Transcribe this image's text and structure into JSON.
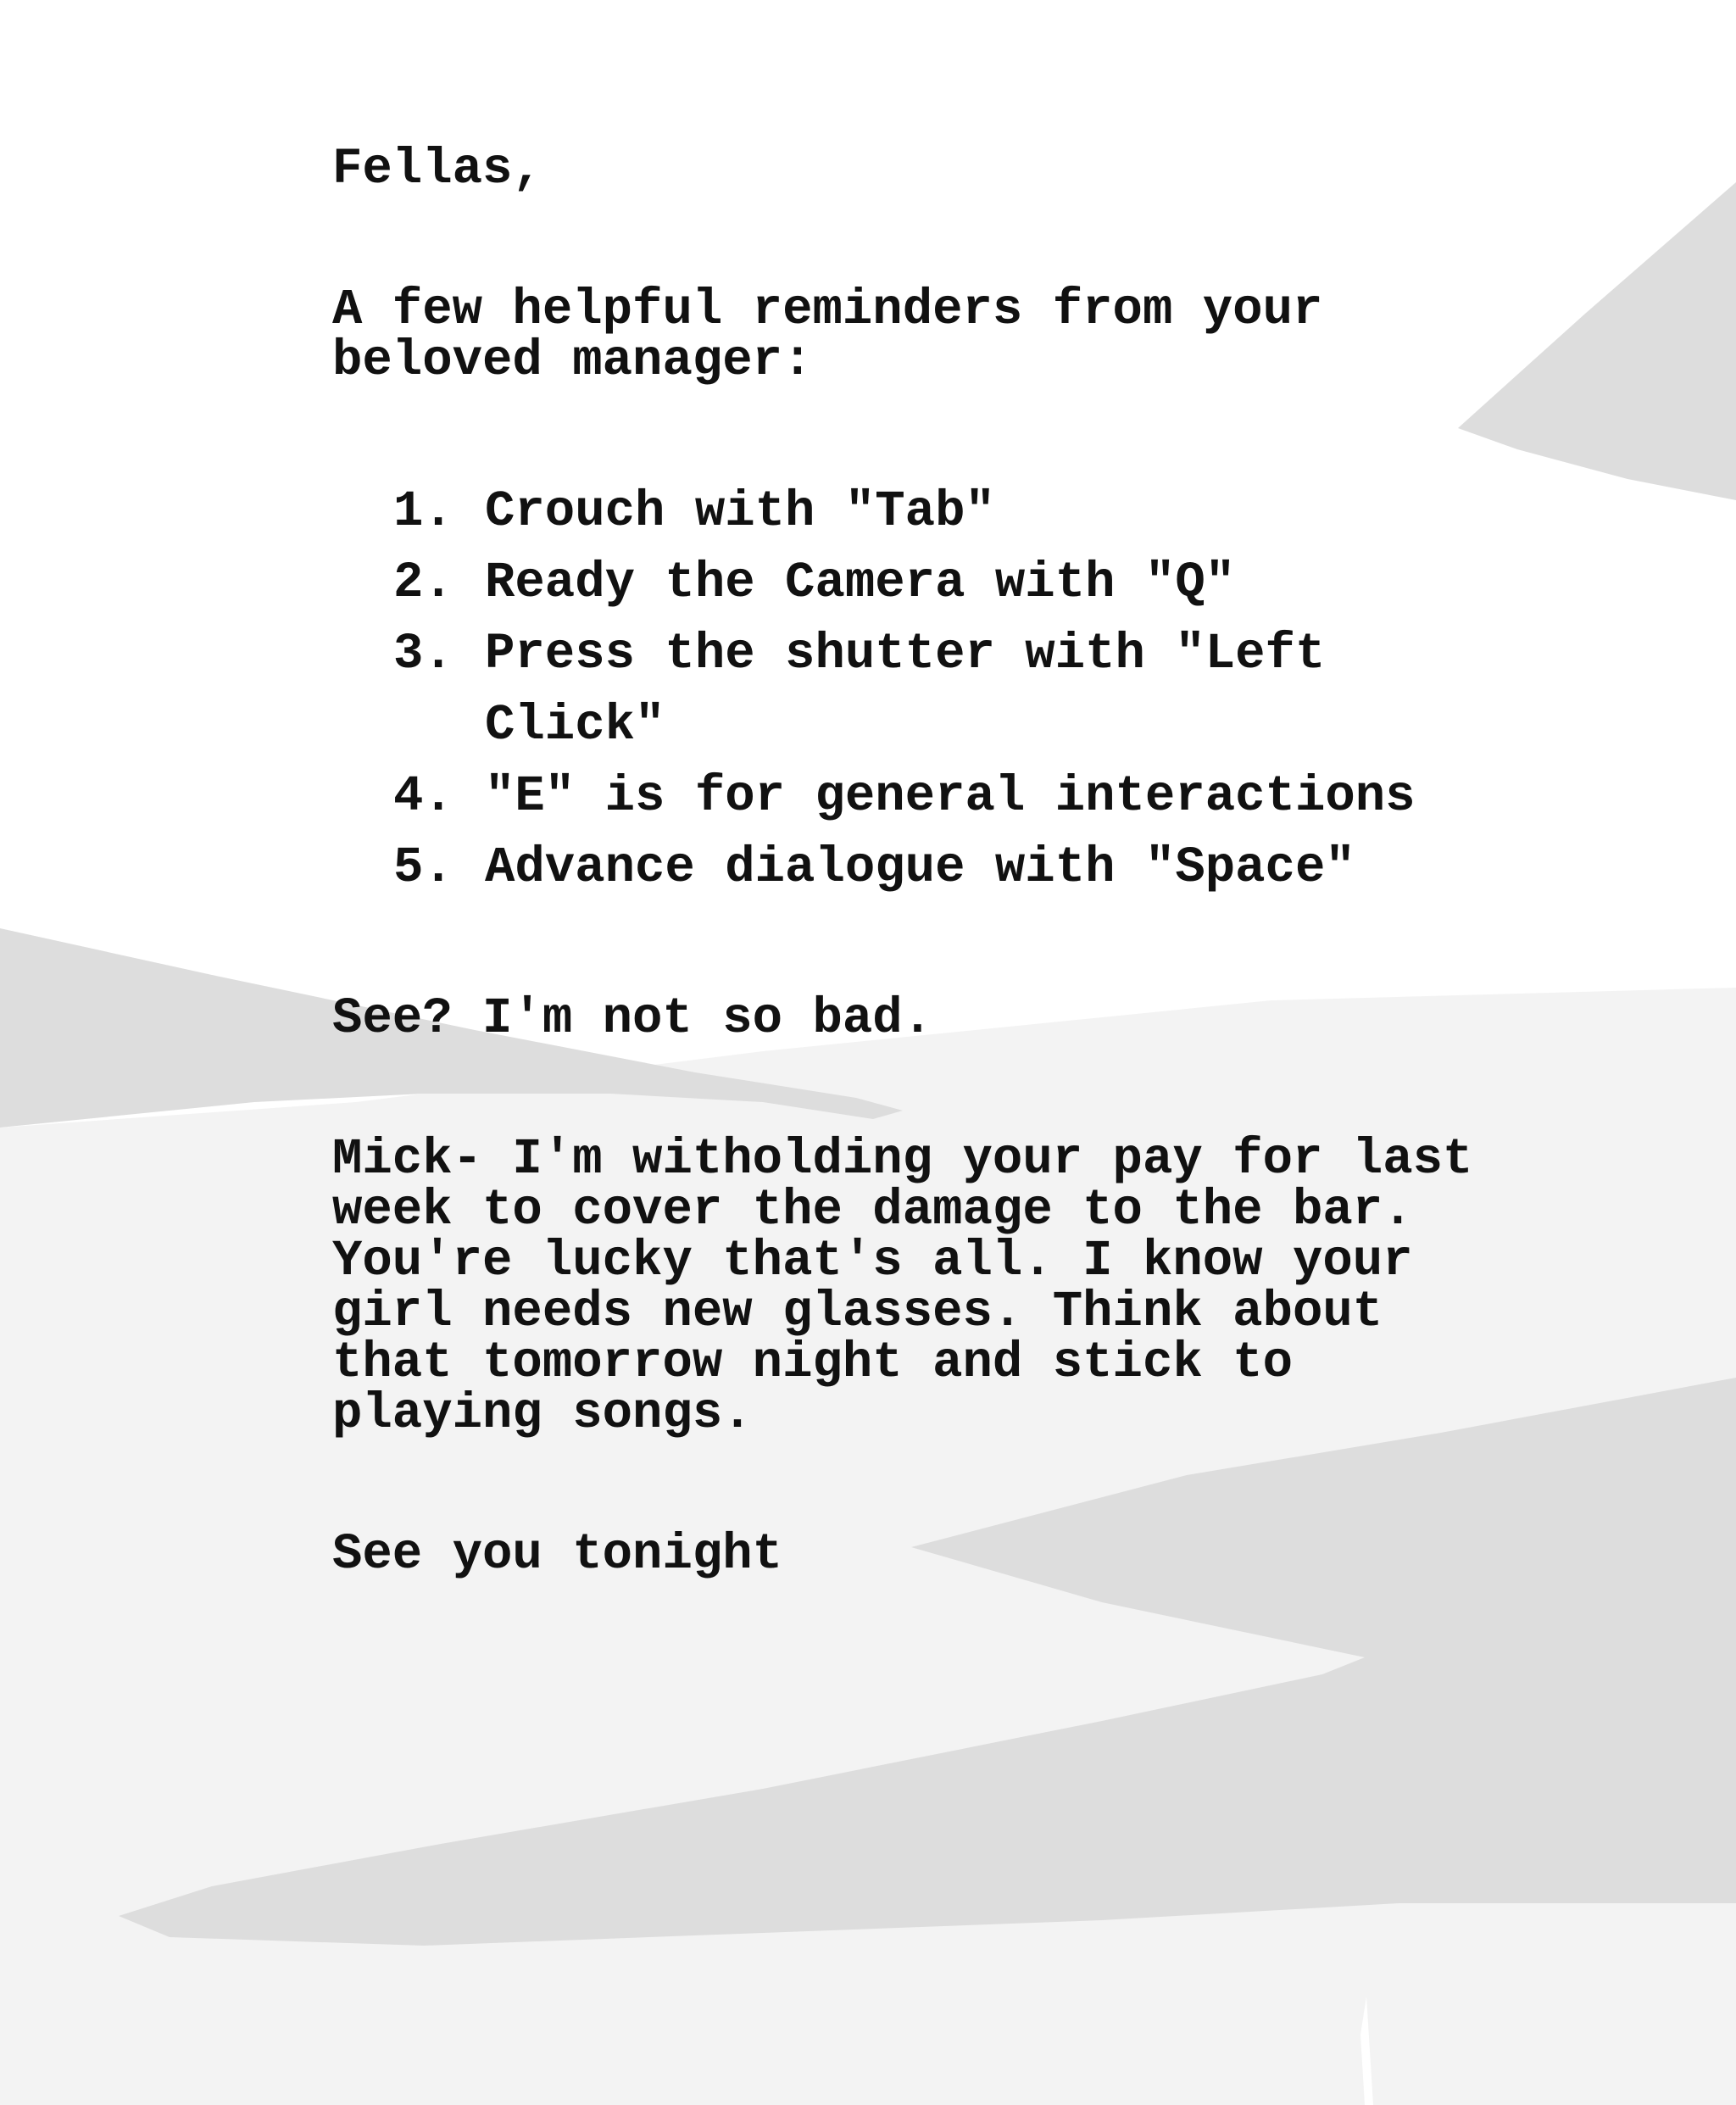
{
  "note": {
    "greeting": "Fellas,",
    "intro": "A few helpful reminders from your\nbeloved manager:",
    "reminders": [
      {
        "number": "1.",
        "text": "Crouch with \"Tab\""
      },
      {
        "number": "2.",
        "text": "Ready the Camera with \"Q\""
      },
      {
        "number": "3.",
        "text": "Press the shutter with \"Left Click\""
      },
      {
        "number": "4.",
        "text": "\"E\" is for general interactions"
      },
      {
        "number": "5.",
        "text": "Advance dialogue with \"Space\""
      }
    ],
    "closing_remark": "See? I'm not so bad.",
    "mick_note": "Mick- I'm witholding your pay for last\nweek to cover the damage to the bar.\nYou're lucky that's all. I know your\ngirl needs new glasses. Think about\nthat tomorrow night and stick to\nplaying songs.",
    "sign_off": "See you tonight"
  },
  "colors": {
    "paper": "#ffffff",
    "shadow_light": "#f3f3f3",
    "shadow_dark": "#dddddd",
    "ink": "#111111"
  }
}
